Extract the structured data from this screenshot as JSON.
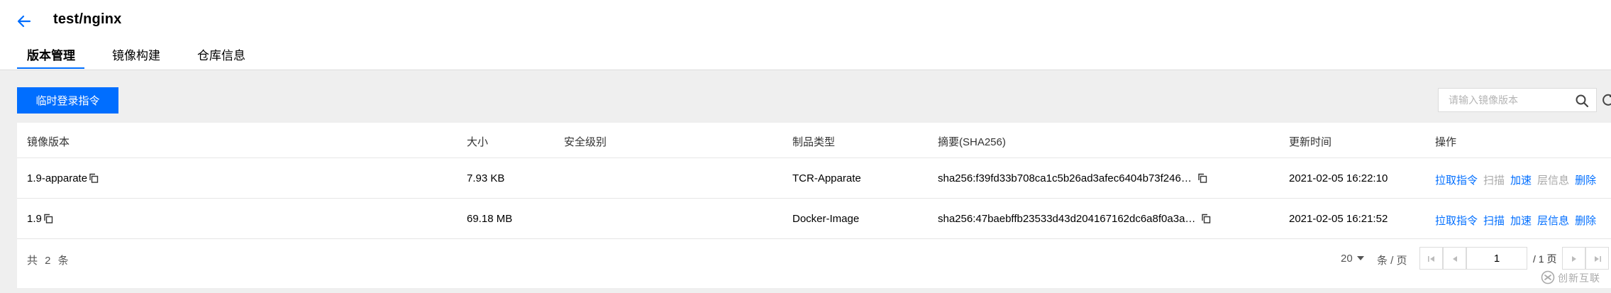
{
  "header": {
    "title": "test/nginx",
    "tabs": [
      {
        "label": "版本管理",
        "active": true
      },
      {
        "label": "镜像构建",
        "active": false
      },
      {
        "label": "仓库信息",
        "active": false
      }
    ]
  },
  "toolbar": {
    "temp_login_label": "临时登录指令",
    "search_placeholder": "请输入镜像版本"
  },
  "table": {
    "columns": [
      "镜像版本",
      "大小",
      "安全级别",
      "制品类型",
      "摘要(SHA256)",
      "更新时间",
      "操作"
    ],
    "rows": [
      {
        "version": "1.9-apparate",
        "size": "7.93 KB",
        "security": "",
        "artifact_type": "TCR-Apparate",
        "digest": "sha256:f39fd33b708ca1c5b26ad3afec6404b73f246…",
        "updated": "2021-02-05 16:22:10",
        "actions": [
          {
            "label": "拉取指令",
            "enabled": true
          },
          {
            "label": "扫描",
            "enabled": false
          },
          {
            "label": "加速",
            "enabled": true
          },
          {
            "label": "层信息",
            "enabled": false
          },
          {
            "label": "删除",
            "enabled": true
          }
        ]
      },
      {
        "version": "1.9",
        "size": "69.18 MB",
        "security": "",
        "artifact_type": "Docker-Image",
        "digest": "sha256:47baebffb23533d43d204167162dc6a8f0a3a…",
        "updated": "2021-02-05 16:21:52",
        "actions": [
          {
            "label": "拉取指令",
            "enabled": true
          },
          {
            "label": "扫描",
            "enabled": true
          },
          {
            "label": "加速",
            "enabled": true
          },
          {
            "label": "层信息",
            "enabled": true
          },
          {
            "label": "删除",
            "enabled": true
          }
        ]
      }
    ]
  },
  "footer": {
    "total_text": "共 2 条",
    "page_size": "20",
    "per_page_label": "条 / 页",
    "current_page": "1",
    "page_total": "/ 1 页"
  },
  "watermark": {
    "text": "创新互联"
  },
  "colors": {
    "accent": "#006eff",
    "disabled": "#a8a8a8",
    "page_bg": "#efefef"
  },
  "icons": [
    "back-arrow-icon",
    "copy-icon",
    "search-icon",
    "refresh-icon",
    "first-page-icon",
    "prev-page-icon",
    "next-page-icon",
    "last-page-icon",
    "caret-down-icon"
  ]
}
